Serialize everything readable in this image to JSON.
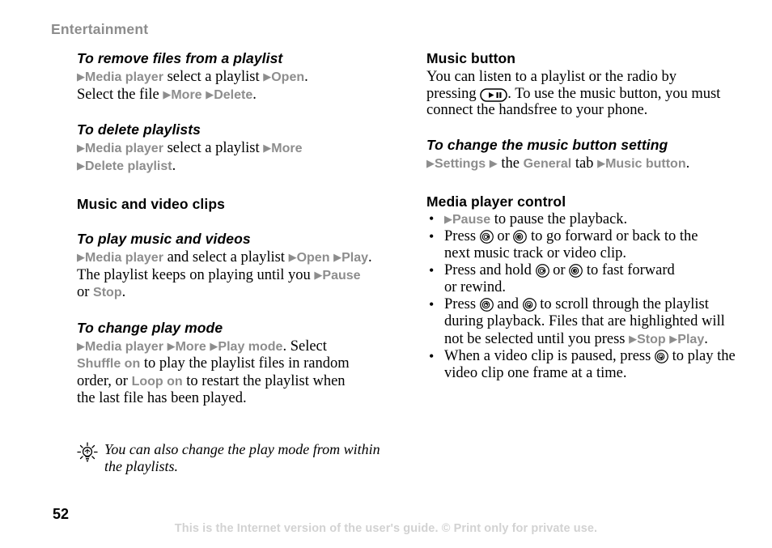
{
  "document": {
    "chapter": "Entertainment",
    "page_number": "52",
    "footer": "This is the Internet version of the user's guide. © Print only for private use.",
    "colors": {
      "menu_term": "#8d8d8d",
      "chapter_header": "#8d8d8d",
      "footer": "#d2d2d2",
      "body_text": "#000000"
    }
  },
  "left_column": {
    "blocks": [
      {
        "type": "task",
        "title": "To remove files from a playlist",
        "lines": [
          [
            {
              "t": "arrow",
              "v": "▶"
            },
            {
              "t": "menu",
              "v": "Media player"
            },
            {
              "t": "text",
              "v": " select a playlist "
            },
            {
              "t": "arrow",
              "v": "▶"
            },
            {
              "t": "menu",
              "v": "Open"
            },
            {
              "t": "text",
              "v": "."
            }
          ],
          [
            {
              "t": "text",
              "v": "Select the file "
            },
            {
              "t": "arrow",
              "v": "▶"
            },
            {
              "t": "menu",
              "v": "More"
            },
            {
              "t": "text",
              "v": " "
            },
            {
              "t": "arrow",
              "v": "▶"
            },
            {
              "t": "menu",
              "v": "Delete"
            },
            {
              "t": "text",
              "v": "."
            }
          ]
        ]
      },
      {
        "type": "task",
        "title": "To delete playlists",
        "lines": [
          [
            {
              "t": "arrow",
              "v": "▶"
            },
            {
              "t": "menu",
              "v": "Media player"
            },
            {
              "t": "text",
              "v": " select a playlist "
            },
            {
              "t": "arrow",
              "v": "▶"
            },
            {
              "t": "menu",
              "v": "More"
            }
          ],
          [
            {
              "t": "arrow",
              "v": "▶"
            },
            {
              "t": "menu",
              "v": "Delete playlist"
            },
            {
              "t": "text",
              "v": "."
            }
          ]
        ]
      },
      {
        "type": "section",
        "title": "Music and video clips"
      },
      {
        "type": "task",
        "title": "To play music and videos",
        "lines": [
          [
            {
              "t": "arrow",
              "v": "▶"
            },
            {
              "t": "menu",
              "v": "Media player"
            },
            {
              "t": "text",
              "v": " and select a playlist "
            },
            {
              "t": "arrow",
              "v": "▶"
            },
            {
              "t": "menu",
              "v": "Open"
            },
            {
              "t": "text",
              "v": " "
            },
            {
              "t": "arrow",
              "v": "▶"
            },
            {
              "t": "menu",
              "v": "Play"
            },
            {
              "t": "text",
              "v": "."
            }
          ],
          [
            {
              "t": "text",
              "v": "The playlist keeps on playing until you "
            },
            {
              "t": "arrow",
              "v": "▶"
            },
            {
              "t": "menu",
              "v": "Pause"
            }
          ],
          [
            {
              "t": "text",
              "v": "or "
            },
            {
              "t": "menu",
              "v": "Stop"
            },
            {
              "t": "text",
              "v": "."
            }
          ]
        ]
      },
      {
        "type": "task",
        "title": "To change play mode",
        "lines": [
          [
            {
              "t": "arrow",
              "v": "▶"
            },
            {
              "t": "menu",
              "v": "Media player"
            },
            {
              "t": "text",
              "v": " "
            },
            {
              "t": "arrow",
              "v": "▶"
            },
            {
              "t": "menu",
              "v": "More"
            },
            {
              "t": "text",
              "v": " "
            },
            {
              "t": "arrow",
              "v": "▶"
            },
            {
              "t": "menu",
              "v": "Play mode"
            },
            {
              "t": "text",
              "v": ". Select"
            }
          ],
          [
            {
              "t": "menu",
              "v": "Shuffle on"
            },
            {
              "t": "text",
              "v": " to play the playlist files in random"
            }
          ],
          [
            {
              "t": "text",
              "v": "order, or "
            },
            {
              "t": "menu",
              "v": "Loop on"
            },
            {
              "t": "text",
              "v": " to restart the playlist when"
            }
          ],
          [
            {
              "t": "text",
              "v": "the last file has been played."
            }
          ]
        ]
      }
    ],
    "tip": {
      "icon": "lightbulb-icon",
      "lines": [
        "You can also change the play mode from within",
        "the playlists."
      ]
    }
  },
  "right_column": {
    "blocks": [
      {
        "type": "section",
        "title": "Music button",
        "lines": [
          [
            {
              "t": "text",
              "v": "You can listen to a playlist or the radio by"
            }
          ],
          [
            {
              "t": "text",
              "v": "pressing "
            },
            {
              "t": "icon",
              "v": "play-pause-button-icon"
            },
            {
              "t": "text",
              "v": ". To use the music button, you must"
            }
          ],
          [
            {
              "t": "text",
              "v": "connect the handsfree to your phone."
            }
          ]
        ]
      },
      {
        "type": "task",
        "title": "To change the music button setting",
        "lines": [
          [
            {
              "t": "arrow",
              "v": "▶"
            },
            {
              "t": "menu",
              "v": "Settings"
            },
            {
              "t": "text",
              "v": " "
            },
            {
              "t": "arrow",
              "v": "▶"
            },
            {
              "t": "text",
              "v": " the "
            },
            {
              "t": "menu",
              "v": "General"
            },
            {
              "t": "text",
              "v": " tab "
            },
            {
              "t": "arrow",
              "v": "▶"
            },
            {
              "t": "menu",
              "v": "Music button"
            },
            {
              "t": "text",
              "v": "."
            }
          ]
        ]
      },
      {
        "type": "section",
        "title": "Media player control",
        "bullets": [
          {
            "lines": [
              [
                {
                  "t": "arrow",
                  "v": "▶"
                },
                {
                  "t": "menu",
                  "v": "Pause"
                },
                {
                  "t": "text",
                  "v": " to pause the playback."
                }
              ]
            ]
          },
          {
            "lines": [
              [
                {
                  "t": "text",
                  "v": "Press "
                },
                {
                  "t": "icon",
                  "v": "nav-key-right-icon"
                },
                {
                  "t": "text",
                  "v": " or "
                },
                {
                  "t": "icon",
                  "v": "nav-key-left-icon"
                },
                {
                  "t": "text",
                  "v": " to go forward or back to the"
                }
              ],
              [
                {
                  "t": "text",
                  "v": "next music track or video clip."
                }
              ]
            ]
          },
          {
            "lines": [
              [
                {
                  "t": "text",
                  "v": "Press and hold "
                },
                {
                  "t": "icon",
                  "v": "nav-key-right-icon"
                },
                {
                  "t": "text",
                  "v": " or "
                },
                {
                  "t": "icon",
                  "v": "nav-key-left-icon"
                },
                {
                  "t": "text",
                  "v": " to fast forward"
                }
              ],
              [
                {
                  "t": "text",
                  "v": "or rewind."
                }
              ]
            ]
          },
          {
            "lines": [
              [
                {
                  "t": "text",
                  "v": "Press "
                },
                {
                  "t": "icon",
                  "v": "nav-key-up-icon"
                },
                {
                  "t": "text",
                  "v": " and "
                },
                {
                  "t": "icon",
                  "v": "nav-key-down-icon"
                },
                {
                  "t": "text",
                  "v": " to scroll through the playlist"
                }
              ],
              [
                {
                  "t": "text",
                  "v": "during playback. Files that are highlighted will"
                }
              ],
              [
                {
                  "t": "text",
                  "v": "not be selected until you press "
                },
                {
                  "t": "arrow",
                  "v": "▶"
                },
                {
                  "t": "menu",
                  "v": "Stop"
                },
                {
                  "t": "text",
                  "v": " "
                },
                {
                  "t": "arrow",
                  "v": "▶"
                },
                {
                  "t": "menu",
                  "v": "Play"
                },
                {
                  "t": "text",
                  "v": "."
                }
              ]
            ]
          },
          {
            "lines": [
              [
                {
                  "t": "text",
                  "v": "When a video clip is paused, press "
                },
                {
                  "t": "icon",
                  "v": "nav-key-down-icon"
                },
                {
                  "t": "text",
                  "v": " to play the"
                }
              ],
              [
                {
                  "t": "text",
                  "v": "video clip one frame at a time."
                }
              ]
            ]
          }
        ]
      }
    ]
  }
}
